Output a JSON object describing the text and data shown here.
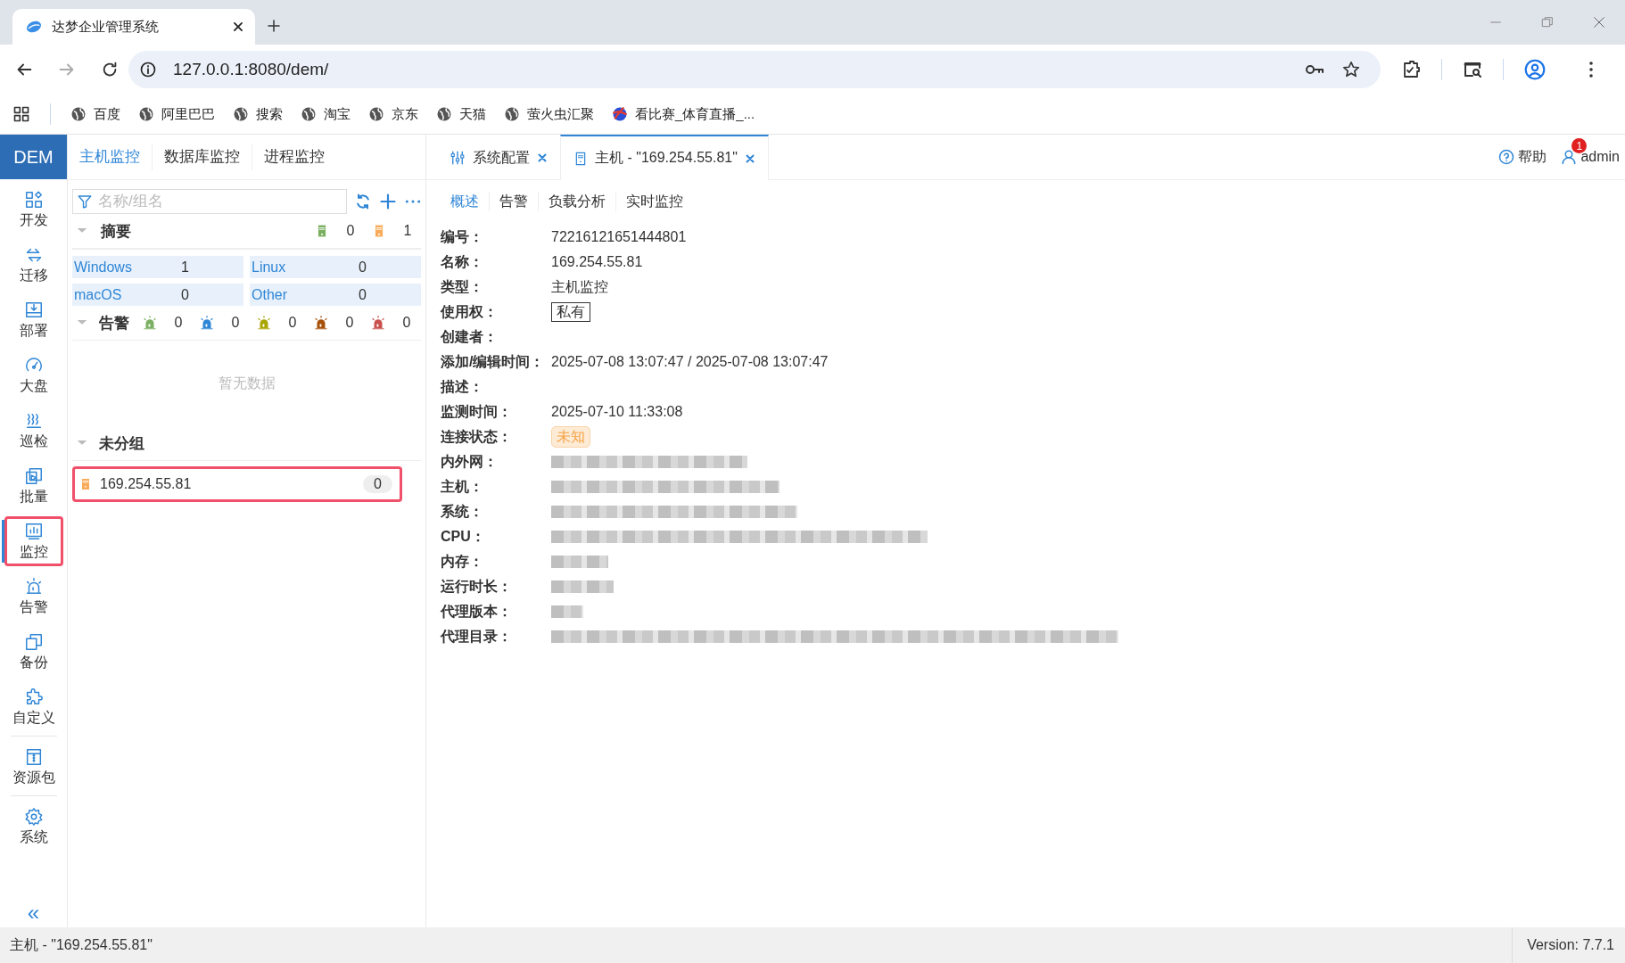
{
  "browser": {
    "tab_title": "达梦企业管理系统",
    "url": "127.0.0.1:8080/dem/",
    "bookmarks": [
      {
        "label": "百度",
        "kind": "globe"
      },
      {
        "label": "阿里巴巴",
        "kind": "globe"
      },
      {
        "label": "搜索",
        "kind": "globe"
      },
      {
        "label": "淘宝",
        "kind": "globe"
      },
      {
        "label": "京东",
        "kind": "globe"
      },
      {
        "label": "天猫",
        "kind": "globe"
      },
      {
        "label": "萤火虫汇聚",
        "kind": "globe"
      },
      {
        "label": "看比赛_体育直播_...",
        "kind": "ball"
      }
    ]
  },
  "app": {
    "logo": "DEM",
    "module_tabs": [
      {
        "label": "主机监控",
        "selected": true
      },
      {
        "label": "数据库监控",
        "selected": false
      },
      {
        "label": "进程监控",
        "selected": false
      }
    ],
    "sidebar": {
      "items": [
        {
          "label": "开发",
          "selected": false,
          "highlighted": false
        },
        {
          "label": "迁移",
          "selected": false,
          "highlighted": false
        },
        {
          "label": "部署",
          "selected": false,
          "highlighted": false
        },
        {
          "label": "大盘",
          "selected": false,
          "highlighted": false
        },
        {
          "label": "巡检",
          "selected": false,
          "highlighted": false
        },
        {
          "label": "批量",
          "selected": false,
          "highlighted": false
        },
        {
          "label": "监控",
          "selected": true,
          "highlighted": true
        },
        {
          "label": "告警",
          "selected": false,
          "highlighted": false
        },
        {
          "label": "备份",
          "selected": false,
          "highlighted": false
        },
        {
          "label": "自定义",
          "selected": false,
          "highlighted": false
        },
        {
          "label": "资源包",
          "selected": false,
          "highlighted": false
        },
        {
          "label": "系统",
          "selected": false,
          "highlighted": false
        }
      ],
      "collapse": "«"
    },
    "filter": {
      "placeholder": "名称/组名"
    },
    "summary": {
      "title": "摘要",
      "expanded": true,
      "servers": [
        {
          "color": "#7bb062",
          "count": "0"
        },
        {
          "color": "#f8ac59",
          "count": "1"
        }
      ],
      "os": [
        {
          "name": "Windows",
          "count": "1"
        },
        {
          "name": "Linux",
          "count": "0"
        },
        {
          "name": "macOS",
          "count": "0"
        },
        {
          "name": "Other",
          "count": "0"
        }
      ]
    },
    "alarms": {
      "title": "告警",
      "expanded": true,
      "levels": [
        {
          "color": "#7bb062",
          "count": "0"
        },
        {
          "color": "#2f86d6",
          "count": "0"
        },
        {
          "color": "#a8a400",
          "count": "0"
        },
        {
          "color": "#a6500a",
          "count": "0"
        },
        {
          "color": "#c9504d",
          "count": "0"
        }
      ],
      "empty_text": "暂无数据"
    },
    "groups": [
      {
        "name": "未分组",
        "expanded": true,
        "hosts": [
          {
            "name": "169.254.55.81",
            "count": "0",
            "color": "#f8ac59",
            "highlighted": true
          }
        ]
      }
    ],
    "open_tabs": [
      {
        "label": "系统配置",
        "selected": false
      },
      {
        "label": "主机 - \"169.254.55.81\"",
        "selected": true
      }
    ],
    "help": "帮助",
    "user": {
      "name": "admin",
      "badge": "1"
    },
    "detail_tabs": [
      {
        "label": "概述",
        "selected": true
      },
      {
        "label": "告警",
        "selected": false
      },
      {
        "label": "负载分析",
        "selected": false
      },
      {
        "label": "实时监控",
        "selected": false
      }
    ],
    "fields": [
      {
        "label": "编号：",
        "kind": "text",
        "value": "72216121651444801"
      },
      {
        "label": "名称：",
        "kind": "text",
        "value": "169.254.55.81"
      },
      {
        "label": "类型：",
        "kind": "text",
        "value": "主机监控"
      },
      {
        "label": "使用权：",
        "kind": "tag",
        "value": "私有"
      },
      {
        "label": "创建者：",
        "kind": "empty"
      },
      {
        "label": "添加/编辑时间：",
        "kind": "text",
        "value": "2025-07-08 13:07:47 / 2025-07-08 13:07:47"
      },
      {
        "label": "描述：",
        "kind": "empty"
      },
      {
        "label": "监测时间：",
        "kind": "text",
        "value": "2025-07-10 11:33:08"
      },
      {
        "label": "连接状态：",
        "kind": "status",
        "value": "未知"
      },
      {
        "label": "内外网：",
        "kind": "blurred"
      },
      {
        "label": "主机：",
        "kind": "blurred"
      },
      {
        "label": "系统：",
        "kind": "blurred"
      },
      {
        "label": "CPU：",
        "kind": "blurred"
      },
      {
        "label": "内存：",
        "kind": "blurred"
      },
      {
        "label": "运行时长：",
        "kind": "blurred"
      },
      {
        "label": "代理版本：",
        "kind": "blurred"
      },
      {
        "label": "代理目录：",
        "kind": "blurred"
      }
    ],
    "status_bar": {
      "text": "主机 - \"169.254.55.81\"",
      "version": "Version: 7.7.1"
    }
  }
}
